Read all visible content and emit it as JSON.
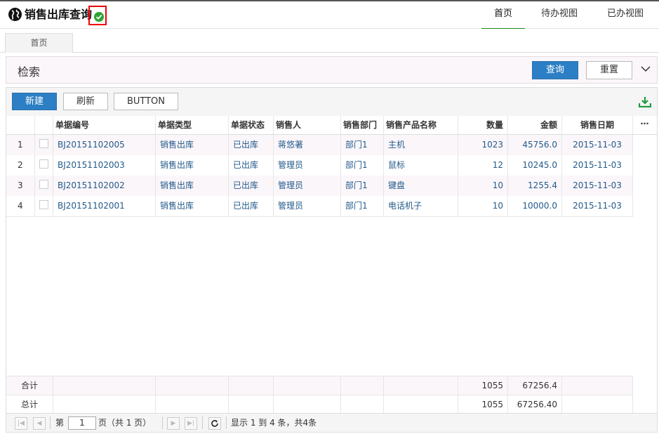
{
  "header": {
    "title": "销售出库查询",
    "nav": [
      "首页",
      "待办视图",
      "已办视图"
    ],
    "active_nav": "首页",
    "accent_color": "#1a8a1a"
  },
  "tabs": [
    "首页"
  ],
  "search": {
    "title": "检索",
    "query_label": "查询",
    "reset_label": "重置"
  },
  "toolbar": {
    "new_label": "新建",
    "refresh_label": "刷新",
    "button_label": "BUTTON"
  },
  "table": {
    "columns": [
      "",
      "",
      "单据编号",
      "单据类型",
      "单据状态",
      "销售人",
      "销售部门",
      "销售产品名称",
      "数量",
      "金额",
      "销售日期"
    ],
    "more": "⋯",
    "rows": [
      {
        "no": "1",
        "code": "BJ20151102005",
        "type": "销售出库",
        "status": "已出库",
        "seller": "蒋悠著",
        "dept": "部门1",
        "product": "主机",
        "qty": "1023",
        "amount": "45756.0",
        "date": "2015-11-03"
      },
      {
        "no": "2",
        "code": "BJ20151102003",
        "type": "销售出库",
        "status": "已出库",
        "seller": "管理员",
        "dept": "部门1",
        "product": "鼠标",
        "qty": "12",
        "amount": "10245.0",
        "date": "2015-11-03"
      },
      {
        "no": "3",
        "code": "BJ20151102002",
        "type": "销售出库",
        "status": "已出库",
        "seller": "管理员",
        "dept": "部门1",
        "product": "键盘",
        "qty": "10",
        "amount": "1255.4",
        "date": "2015-11-03"
      },
      {
        "no": "4",
        "code": "BJ20151102001",
        "type": "销售出库",
        "status": "已出库",
        "seller": "管理员",
        "dept": "部门1",
        "product": "电话机子",
        "qty": "10",
        "amount": "10000.0",
        "date": "2015-11-03"
      }
    ],
    "subtotal": {
      "label": "合计",
      "qty": "1055",
      "amount": "67256.4"
    },
    "total": {
      "label": "总计",
      "qty": "1055",
      "amount": "67256.40"
    }
  },
  "pager": {
    "page_prefix": "第",
    "page_value": "1",
    "page_suffix": "页（共 1 页）",
    "summary": "显示 1 到 4 条，共4条"
  }
}
